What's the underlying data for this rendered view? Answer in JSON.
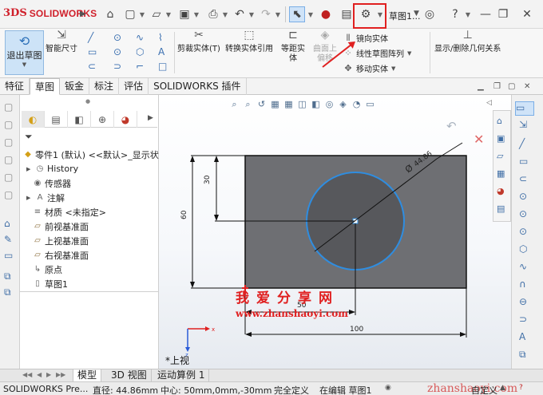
{
  "app": {
    "name": "SOLIDWORKS",
    "logo_prefix": "3DS",
    "document_title": "草图1...",
    "highlight_color": "#e02020",
    "accent_color": "#2a6fb8"
  },
  "quick_access": {
    "icons": [
      "home-icon",
      "new-document-icon",
      "open-icon",
      "save-icon",
      "print-icon",
      "undo-icon",
      "redo-icon",
      "select-icon",
      "rebuild-icon",
      "file-properties-icon",
      "options-gear-icon"
    ],
    "extras": [
      "search-icon",
      "user-icon",
      "help-icon",
      "minimize-icon",
      "restore-icon",
      "close-icon"
    ]
  },
  "command_manager": {
    "exit_sketch": "退出草图",
    "smart_dimension": "智能尺寸",
    "trim_entities": "剪裁实体(T)",
    "convert_entities": "转换实体引用",
    "offset_entities": "等距实体",
    "surface_offset": "曲面上偏移",
    "mirror_entities": "镜向实体",
    "linear_pattern": "线性草图阵列",
    "move_entities": "移动实体",
    "display_relations": "显示/删除几何关系"
  },
  "tabs": [
    "特征",
    "草图",
    "钣金",
    "标注",
    "评估",
    "SOLIDWORKS 插件"
  ],
  "active_tab": "草图",
  "feature_tree": {
    "root": "零件1 (默认) <<默认>_显示状",
    "items": [
      {
        "label": "History",
        "icon": "history-folder-icon"
      },
      {
        "label": "传感器",
        "icon": "sensors-icon"
      },
      {
        "label": "注解",
        "icon": "annotations-icon"
      },
      {
        "label": "材质 <未指定>",
        "icon": "material-icon"
      },
      {
        "label": "前视基准面",
        "icon": "plane-icon"
      },
      {
        "label": "上视基准面",
        "icon": "plane-icon"
      },
      {
        "label": "右视基准面",
        "icon": "plane-icon"
      },
      {
        "label": "原点",
        "icon": "origin-icon"
      },
      {
        "label": "草图1",
        "icon": "sketch-icon"
      }
    ]
  },
  "sketch": {
    "dimensions": {
      "diameter": "44.86",
      "diameter_symbol": "Ø",
      "height_center": "30",
      "height_total": "60",
      "width_center": "50",
      "width_total": "100"
    },
    "fill_color": "#6e6f73",
    "circle_color": "#2f8de0"
  },
  "watermark": {
    "chinese": "我爱分享网",
    "url": "www.zhanshaoyi.com",
    "status_url": "zhanshaoyi.com"
  },
  "view_label": "*上视",
  "bottom_tabs": [
    "模型",
    "3D 视图",
    "运动算例 1"
  ],
  "status": {
    "product": "SOLIDWORKS Pre...",
    "diameter": "直径: 44.86mm",
    "center": "中心: 50mm,0mm,-30mm",
    "definition": "完全定义",
    "editing": "在编辑 草图1",
    "custom": "自定义"
  }
}
